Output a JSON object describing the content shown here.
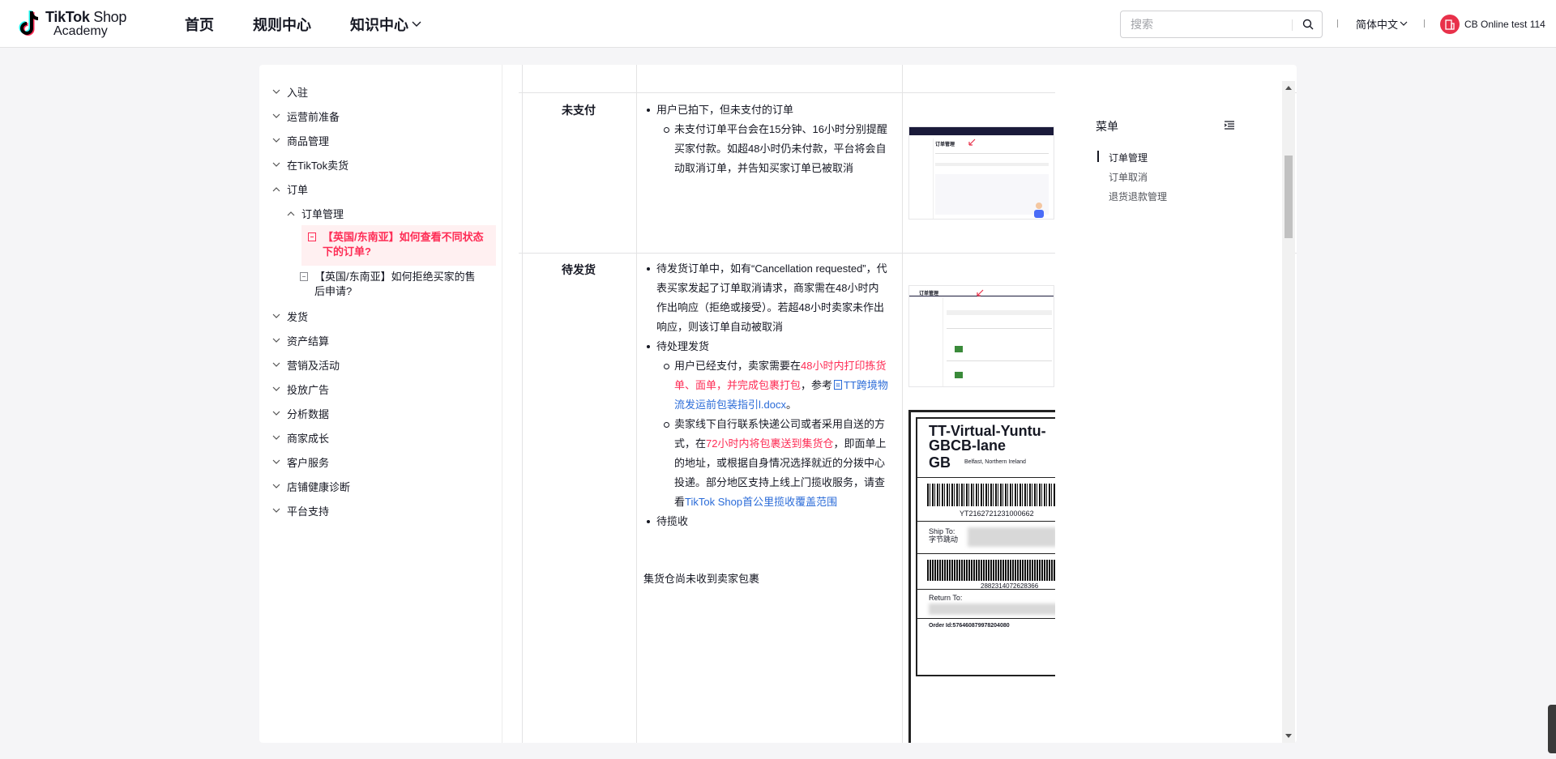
{
  "header": {
    "logo_line1_bold": "TikTok",
    "logo_line1_light": "Shop",
    "logo_line2": "Academy",
    "nav": [
      {
        "label": "首页"
      },
      {
        "label": "规则中心"
      },
      {
        "label": "知识中心"
      }
    ],
    "search_placeholder": "搜索",
    "language": "简体中文",
    "user_name": "CB Online test 114"
  },
  "sidebar": {
    "items": [
      {
        "label": "入驻"
      },
      {
        "label": "运营前准备"
      },
      {
        "label": "商品管理"
      },
      {
        "label": "在TikTok卖货"
      },
      {
        "label": "订单"
      },
      {
        "label": "发货"
      },
      {
        "label": "资产结算"
      },
      {
        "label": "营销及活动"
      },
      {
        "label": "投放广告"
      },
      {
        "label": "分析数据"
      },
      {
        "label": "商家成长"
      },
      {
        "label": "客户服务"
      },
      {
        "label": "店铺健康诊断"
      },
      {
        "label": "平台支持"
      }
    ],
    "sub_item": "订单管理",
    "leaf_active": "【英国/东南亚】如何查看不同状态下的订单?",
    "leaf_2": "【英国/东南亚】如何拒绝买家的售后申请?"
  },
  "table": {
    "row1": {
      "label": "未支付",
      "bullet1": "用户已拍下，但未支付的订单",
      "sub1": "未支付订单平台会在15分钟、16小时分别提醒买家付款。如超48小时仍未付款，平台将会自动取消订单，并告知买家订单已被取消"
    },
    "row2": {
      "label": "待发货",
      "bullet1": "待发货订单中，如有“Cancellation requested”，代表买家发起了订单取消请求，商家需在48小时内作出响应（拒绝或接受）。若超48小时卖家未作出响应，则该订单自动被取消",
      "bullet2": "待处理发货",
      "sub1_a": "用户已经支付，卖家需要在",
      "sub1_red": "48小时内打印拣货单、面单，并完成包裹打包",
      "sub1_b": "，参考",
      "sub1_link": "TT跨境物流发运前包装指引l.docx",
      "sub1_c": "。",
      "sub2_a": "卖家线下自行联系快递公司或者采用自送的方式，在",
      "sub2_red": "72小时内将包裹送到集货仓",
      "sub2_b": "，即面单上的地址，或根据自身情况选择就近的分拨中心投递。部分地区支持上线上门揽收服务，请查看",
      "sub2_link": "TikTok Shop首公里揽收覆盖范围",
      "bullet3": "待揽收",
      "plain": "集货仓尚未收到卖家包裹"
    },
    "label_image": {
      "title1": "TT-Virtual-Yuntu-",
      "title2": "GBCB-lane",
      "country": "GB",
      "city": "Belfast, Northern Ireland",
      "tracking": "YT2162721231000662",
      "ship_to": "Ship To:",
      "ship_addr": "字节跳动",
      "barcode2": "2882314072628366",
      "return_to": "Return To:",
      "order_id": "Order Id:576460879978204080"
    },
    "shot1_title": "订单管理",
    "shot2_title": "订单管理"
  },
  "toc": {
    "title": "菜单",
    "items": [
      {
        "label": "订单管理"
      },
      {
        "label": "订单取消"
      },
      {
        "label": "退货退款管理"
      }
    ]
  },
  "colors": {
    "accent": "#fe2c55",
    "link": "#2a6bd8",
    "text": "#161823"
  }
}
